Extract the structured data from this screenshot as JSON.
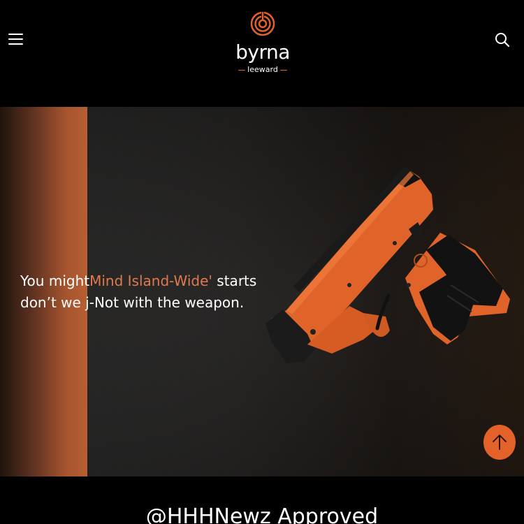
{
  "header": {
    "brand": "byrna",
    "brand_sub": "leeward"
  },
  "hero": {
    "text_part1": "You might",
    "text_accent": "Mind Island-Wide'",
    "text_part2": " starts",
    "text_line2": "don’t we j-Not with the weapon."
  },
  "section": {
    "title": "@HHHNewz Approved"
  },
  "colors": {
    "accent": "#e3622a",
    "accent_text": "#e07a4e",
    "background": "#000000"
  },
  "icons": [
    "menu-icon",
    "search-icon",
    "arrow-up-icon",
    "byrna-logo-mark"
  ]
}
